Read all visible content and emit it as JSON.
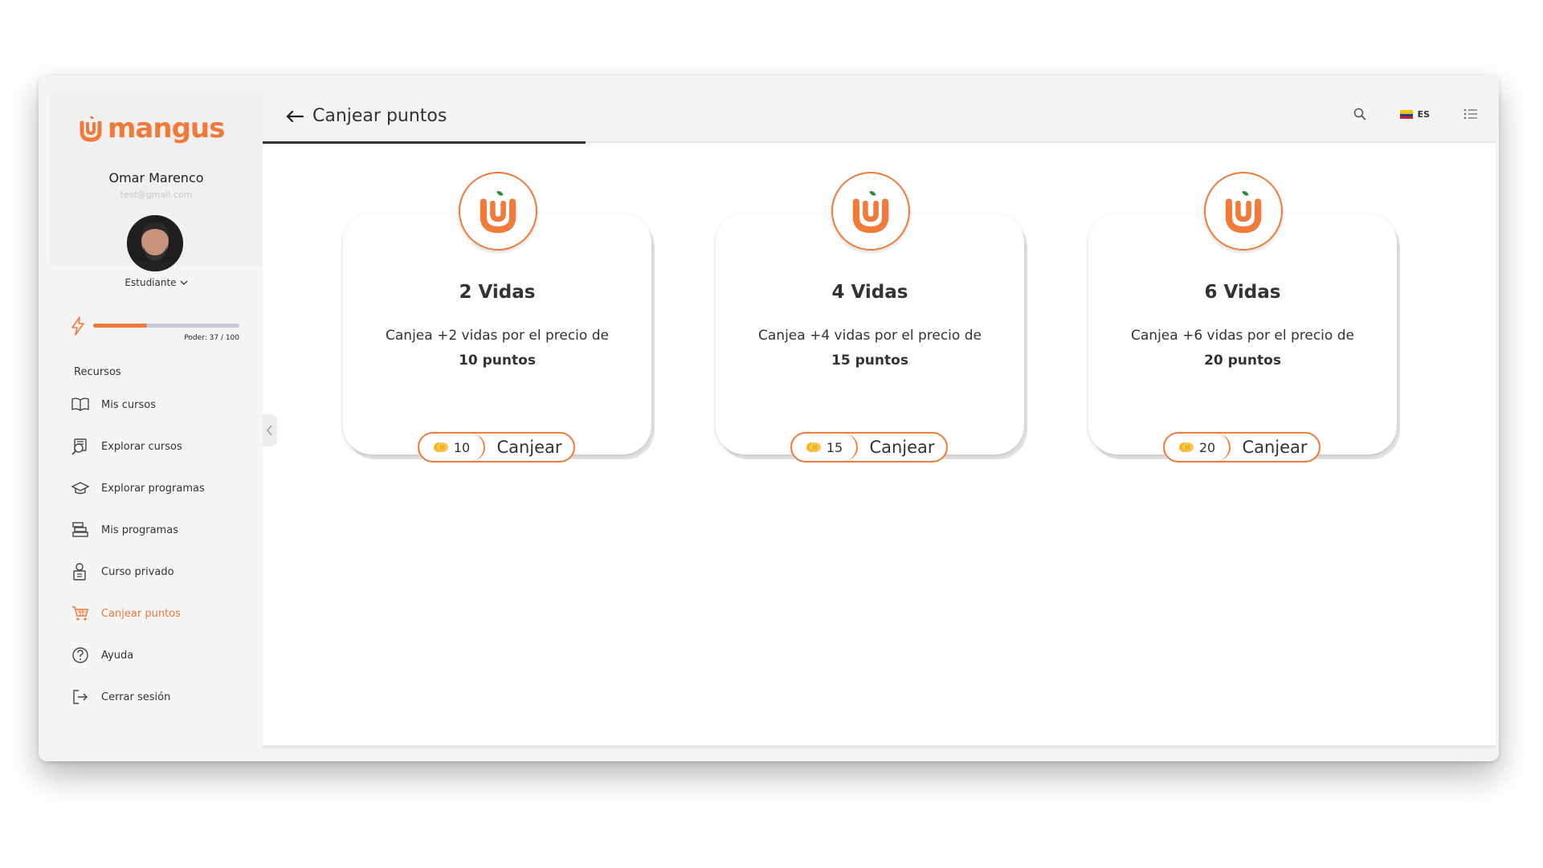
{
  "brand": {
    "name": "mangus",
    "accent": "#f07a3a"
  },
  "user": {
    "name": "Omar Marenco",
    "email": "test@gmail.com",
    "role": "Estudiante"
  },
  "power": {
    "label": "Poder: 37 / 100",
    "value": 37,
    "max": 100
  },
  "sidebar": {
    "section_label": "Recursos",
    "items": [
      {
        "label": "Mis cursos",
        "icon": "book-open-icon",
        "active": false
      },
      {
        "label": "Explorar cursos",
        "icon": "explore-courses-icon",
        "active": false
      },
      {
        "label": "Explorar programas",
        "icon": "graduation-cap-icon",
        "active": false
      },
      {
        "label": "Mis programas",
        "icon": "books-stack-icon",
        "active": false
      },
      {
        "label": "Curso privado",
        "icon": "private-course-icon",
        "active": false
      },
      {
        "label": "Canjear puntos",
        "icon": "shopping-cart-icon",
        "active": true
      },
      {
        "label": "Ayuda",
        "icon": "help-circle-icon",
        "active": false
      },
      {
        "label": "Cerrar sesión",
        "icon": "logout-icon",
        "active": false
      }
    ]
  },
  "header": {
    "title": "Canjear puntos",
    "language": "ES"
  },
  "cards": [
    {
      "title": "2 Vidas",
      "desc": "Canjea +2 vidas por el precio de",
      "points": "10 puntos",
      "price": "10",
      "button": "Canjear"
    },
    {
      "title": "4 Vidas",
      "desc": "Canjea +4 vidas por el precio de",
      "points": "15 puntos",
      "price": "15",
      "button": "Canjear"
    },
    {
      "title": "6 Vidas",
      "desc": "Canjea +6 vidas por el precio de",
      "points": "20 puntos",
      "price": "20",
      "button": "Canjear"
    }
  ]
}
